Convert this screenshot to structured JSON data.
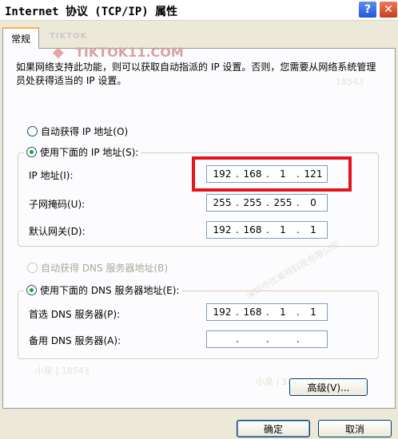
{
  "window": {
    "title": "Internet 协议 (TCP/IP) 属性",
    "help_label": "?",
    "close_label": "✕"
  },
  "tabs": [
    {
      "label": "常规"
    }
  ],
  "watermark": {
    "brand": "TIKTOK",
    "url": "TIKTOK11.COM",
    "faint_texts": [
      "小泉 | 18543",
      "深圳市优莱特科技有限公司",
      "小泉 | 18543",
      "18543"
    ]
  },
  "description": "如果网络支持此功能，则可以获取自动指派的 IP 设置。否则，您需要从网络系统管理员处获得适当的 IP 设置。",
  "ip_section": {
    "auto_label": "自动获得 IP 地址(O)",
    "manual_label": "使用下面的 IP 地址(S):",
    "fields": [
      {
        "label": "IP 地址(I):",
        "octets": [
          "192",
          "168",
          "1",
          "121"
        ]
      },
      {
        "label": "子网掩码(U):",
        "octets": [
          "255",
          "255",
          "255",
          "0"
        ]
      },
      {
        "label": "默认网关(D):",
        "octets": [
          "192",
          "168",
          "1",
          "1"
        ]
      }
    ]
  },
  "dns_section": {
    "auto_label": "自动获得 DNS 服务器地址(B)",
    "manual_label": "使用下面的 DNS 服务器地址(E):",
    "fields": [
      {
        "label": "首选 DNS 服务器(P):",
        "octets": [
          "192",
          "168",
          "1",
          "1"
        ]
      },
      {
        "label": "备用 DNS 服务器(A):",
        "octets": [
          "",
          "",
          "",
          ""
        ]
      }
    ]
  },
  "buttons": {
    "advanced": "高级(V)...",
    "ok": "确定",
    "cancel": "取消"
  },
  "colors": {
    "highlight": "#e3141b",
    "dialog_bg": "#ece9d8",
    "panel_bg": "#fcfcfe",
    "radio_dot": "#21a121"
  }
}
